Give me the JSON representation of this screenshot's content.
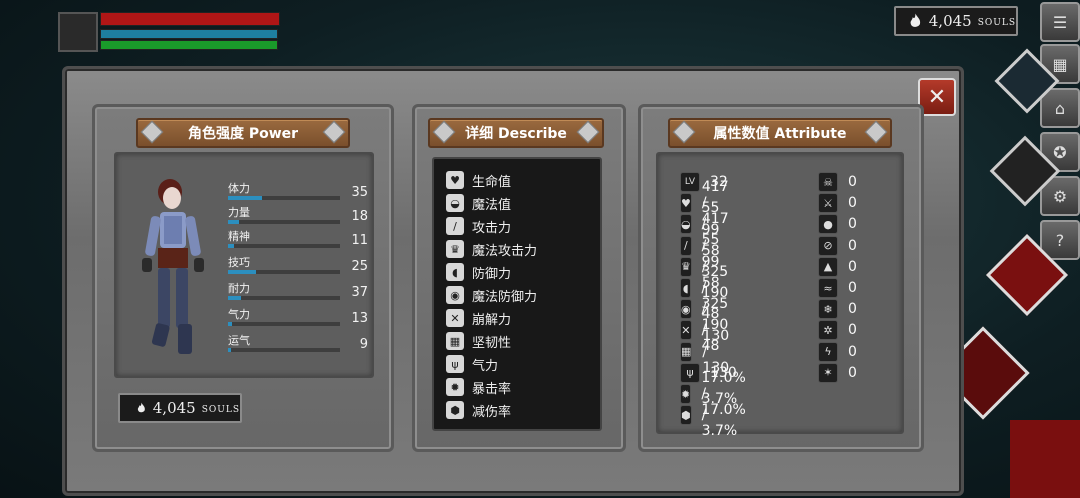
{
  "hud": {
    "souls_count": "4,045",
    "souls_unit": "SOULS"
  },
  "side_buttons": [
    "menu-icon",
    "map-icon",
    "door-icon",
    "emblem-icon",
    "gear-icon",
    "help-icon"
  ],
  "power": {
    "title": "角色强度 Power",
    "stats": [
      {
        "label": "体力",
        "value": "35",
        "fill": 0.3
      },
      {
        "label": "力量",
        "value": "18",
        "fill": 0.1
      },
      {
        "label": "精神",
        "value": "11",
        "fill": 0.05
      },
      {
        "label": "技巧",
        "value": "25",
        "fill": 0.25
      },
      {
        "label": "耐力",
        "value": "37",
        "fill": 0.12
      },
      {
        "label": "气力",
        "value": "13",
        "fill": 0.04
      },
      {
        "label": "运气",
        "value": "9",
        "fill": 0.03
      }
    ],
    "souls_count": "4,045",
    "souls_unit": "SOULS"
  },
  "describe": {
    "title": "详细 Describe",
    "items": [
      {
        "icon": "heart-icon",
        "glyph": "♥",
        "label": "生命值"
      },
      {
        "icon": "potion-icon",
        "glyph": "◒",
        "label": "魔法值"
      },
      {
        "icon": "sword-icon",
        "glyph": "/",
        "label": "攻击力"
      },
      {
        "icon": "crown-icon",
        "glyph": "♛",
        "label": "魔法攻击力"
      },
      {
        "icon": "shield-icon",
        "glyph": "◖",
        "label": "防御力"
      },
      {
        "icon": "magic-shield-icon",
        "glyph": "◉",
        "label": "魔法防御力"
      },
      {
        "icon": "break-icon",
        "glyph": "✕",
        "label": "崩解力"
      },
      {
        "icon": "armor-icon",
        "glyph": "▦",
        "label": "坚韧性"
      },
      {
        "icon": "lungs-icon",
        "glyph": "ψ",
        "label": "气力"
      },
      {
        "icon": "crit-icon",
        "glyph": "✹",
        "label": "暴击率"
      },
      {
        "icon": "reduce-icon",
        "glyph": "⬢",
        "label": "减伤率"
      }
    ]
  },
  "attribute": {
    "title": "属性数值 Attribute",
    "left": [
      {
        "icon": "level-icon",
        "glyph": "LV",
        "value": "32"
      },
      {
        "icon": "heart-icon",
        "glyph": "♥",
        "value": "417 / 417"
      },
      {
        "icon": "potion-icon",
        "glyph": "◒",
        "value": "55 / 55"
      },
      {
        "icon": "sword-icon",
        "glyph": "/",
        "value": "99 / 99"
      },
      {
        "icon": "crown-icon",
        "glyph": "♛",
        "value": "58 / 58"
      },
      {
        "icon": "shield-icon",
        "glyph": "◖",
        "value": "325 / 325"
      },
      {
        "icon": "magic-shield-icon",
        "glyph": "◉",
        "value": "190 / 190"
      },
      {
        "icon": "break-icon",
        "glyph": "✕",
        "value": "48 / 48"
      },
      {
        "icon": "armor-icon",
        "glyph": "▦",
        "value": "130 / 130"
      },
      {
        "icon": "lungs-icon",
        "glyph": "ψ",
        "value": "130"
      },
      {
        "icon": "crit-icon",
        "glyph": "✹",
        "value": "17.0% / 17.0%"
      },
      {
        "icon": "reduce-icon",
        "glyph": "⬢",
        "value": "3.7% / 3.7%"
      }
    ],
    "right": [
      {
        "icon": "skull-icon",
        "glyph": "☠",
        "value": "0"
      },
      {
        "icon": "slash-icon",
        "glyph": "⚔",
        "value": "0"
      },
      {
        "icon": "drop-icon",
        "glyph": "●",
        "value": "0"
      },
      {
        "icon": "pierce-icon",
        "glyph": "⊘",
        "value": "0"
      },
      {
        "icon": "fire-icon",
        "glyph": "▲",
        "value": "0"
      },
      {
        "icon": "poison-icon",
        "glyph": "≈",
        "value": "0"
      },
      {
        "icon": "frost-icon",
        "glyph": "❄",
        "value": "0"
      },
      {
        "icon": "ice-icon",
        "glyph": "✲",
        "value": "0"
      },
      {
        "icon": "lightning-icon",
        "glyph": "ϟ",
        "value": "0"
      },
      {
        "icon": "wind-icon",
        "glyph": "✶",
        "value": "0"
      }
    ]
  }
}
